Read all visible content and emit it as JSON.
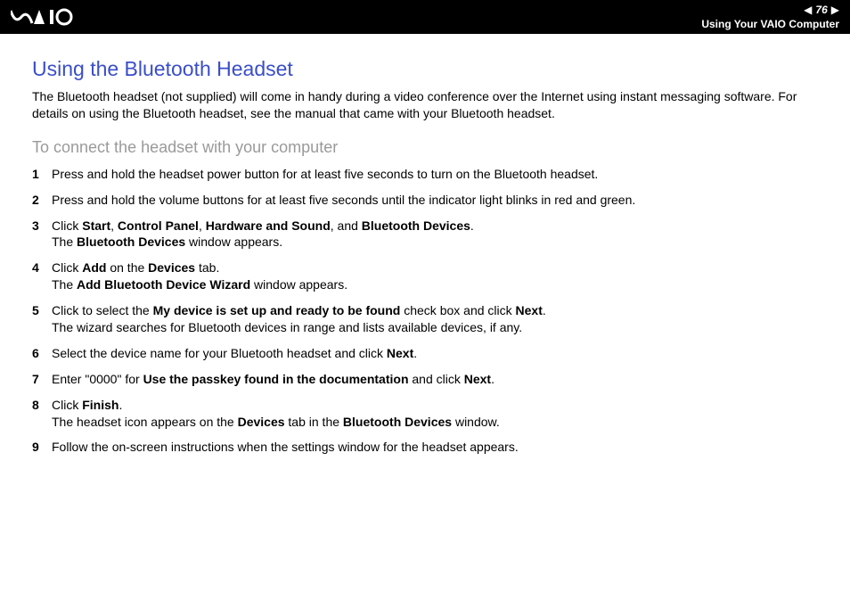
{
  "header": {
    "page_number": "76",
    "section": "Using Your VAIO Computer"
  },
  "title": "Using the Bluetooth Headset",
  "intro": "The Bluetooth headset (not supplied) will come in handy during a video conference over the Internet using instant messaging software. For details on using the Bluetooth headset, see the manual that came with your Bluetooth headset.",
  "subtitle": "To connect the headset with your computer",
  "steps": [
    {
      "html": "Press and hold the headset power button for at least five seconds to turn on the Bluetooth headset."
    },
    {
      "html": "Press and hold the volume buttons for at least five seconds until the indicator light blinks in red and green."
    },
    {
      "html": "Click <b>Start</b>, <b>Control Panel</b>, <b>Hardware and Sound</b>, and <b>Bluetooth Devices</b>.<br>The <b>Bluetooth Devices</b> window appears."
    },
    {
      "html": "Click <b>Add</b> on the <b>Devices</b> tab.<br>The <b>Add Bluetooth Device Wizard</b> window appears."
    },
    {
      "html": "Click to select the <b>My device is set up and ready to be found</b> check box and click <b>Next</b>.<br>The wizard searches for Bluetooth devices in range and lists available devices, if any."
    },
    {
      "html": "Select the device name for your Bluetooth headset and click <b>Next</b>."
    },
    {
      "html": "Enter \"0000\" for <b>Use the passkey found in the documentation</b> and click <b>Next</b>."
    },
    {
      "html": "Click <b>Finish</b>.<br>The headset icon appears on the <b>Devices</b> tab in the <b>Bluetooth Devices</b> window."
    },
    {
      "html": "Follow the on-screen instructions when the settings window for the headset appears."
    }
  ]
}
